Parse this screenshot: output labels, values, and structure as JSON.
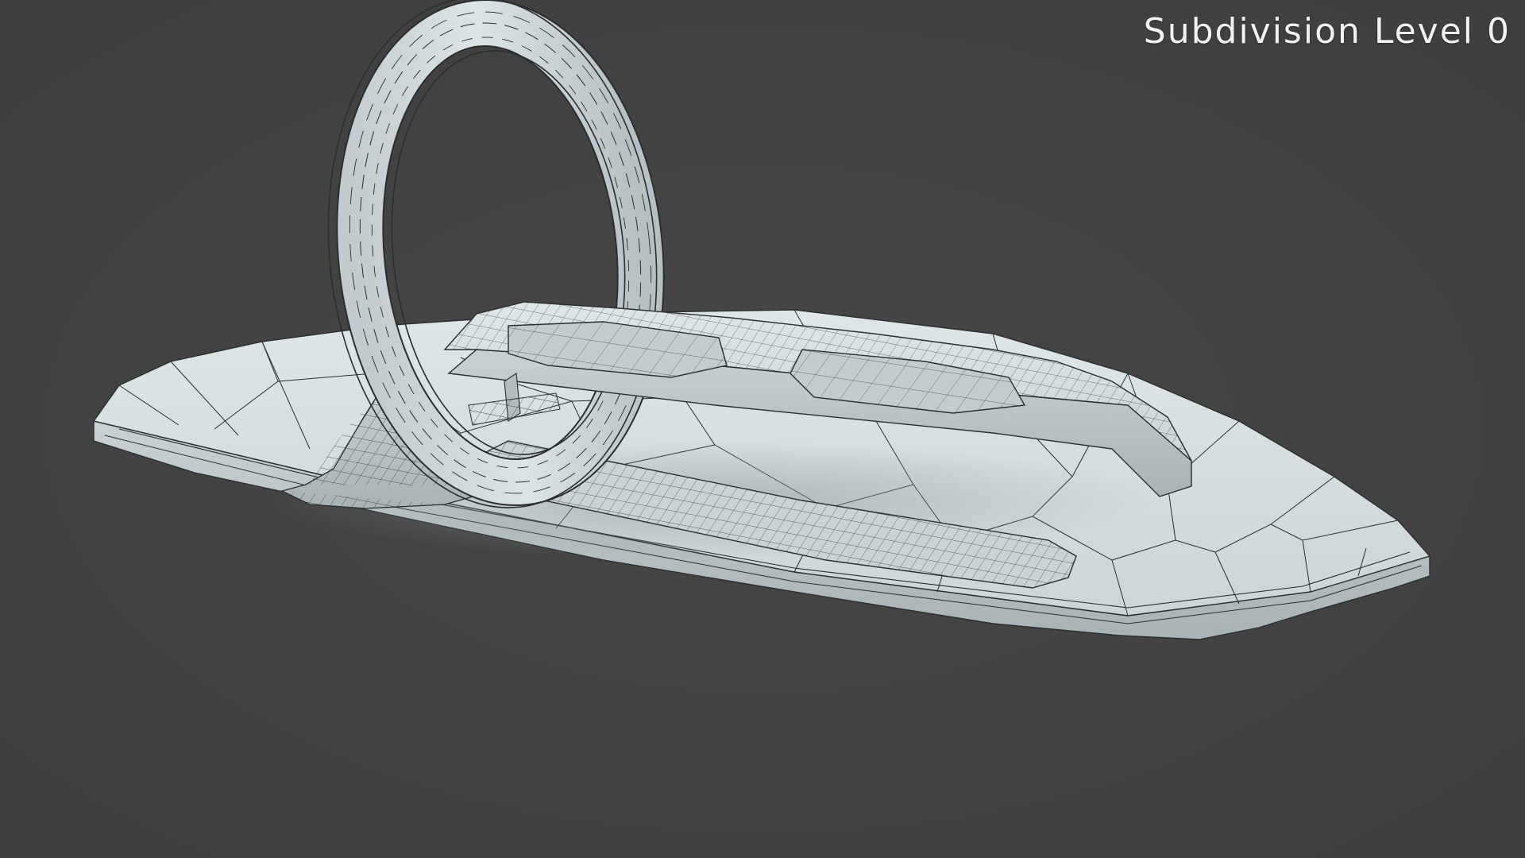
{
  "viewport": {
    "overlay_label": "Subdivision Level 0",
    "background_color": "#434343",
    "mesh_color": "#d3dbdd",
    "wire_color": "#2a2e30",
    "display_mode": "shaded-wireframe"
  },
  "scene": {
    "objects": [
      {
        "name": "base-platform",
        "shape": "rounded-octagonal slab"
      },
      {
        "name": "ring-arch",
        "shape": "torus ring standing upright"
      },
      {
        "name": "ring-support",
        "shape": "flared pedestal"
      },
      {
        "name": "bed-panel",
        "shape": "sculpted elevated board"
      },
      {
        "name": "recessed-strip",
        "shape": "inset grid strip on base"
      }
    ]
  }
}
